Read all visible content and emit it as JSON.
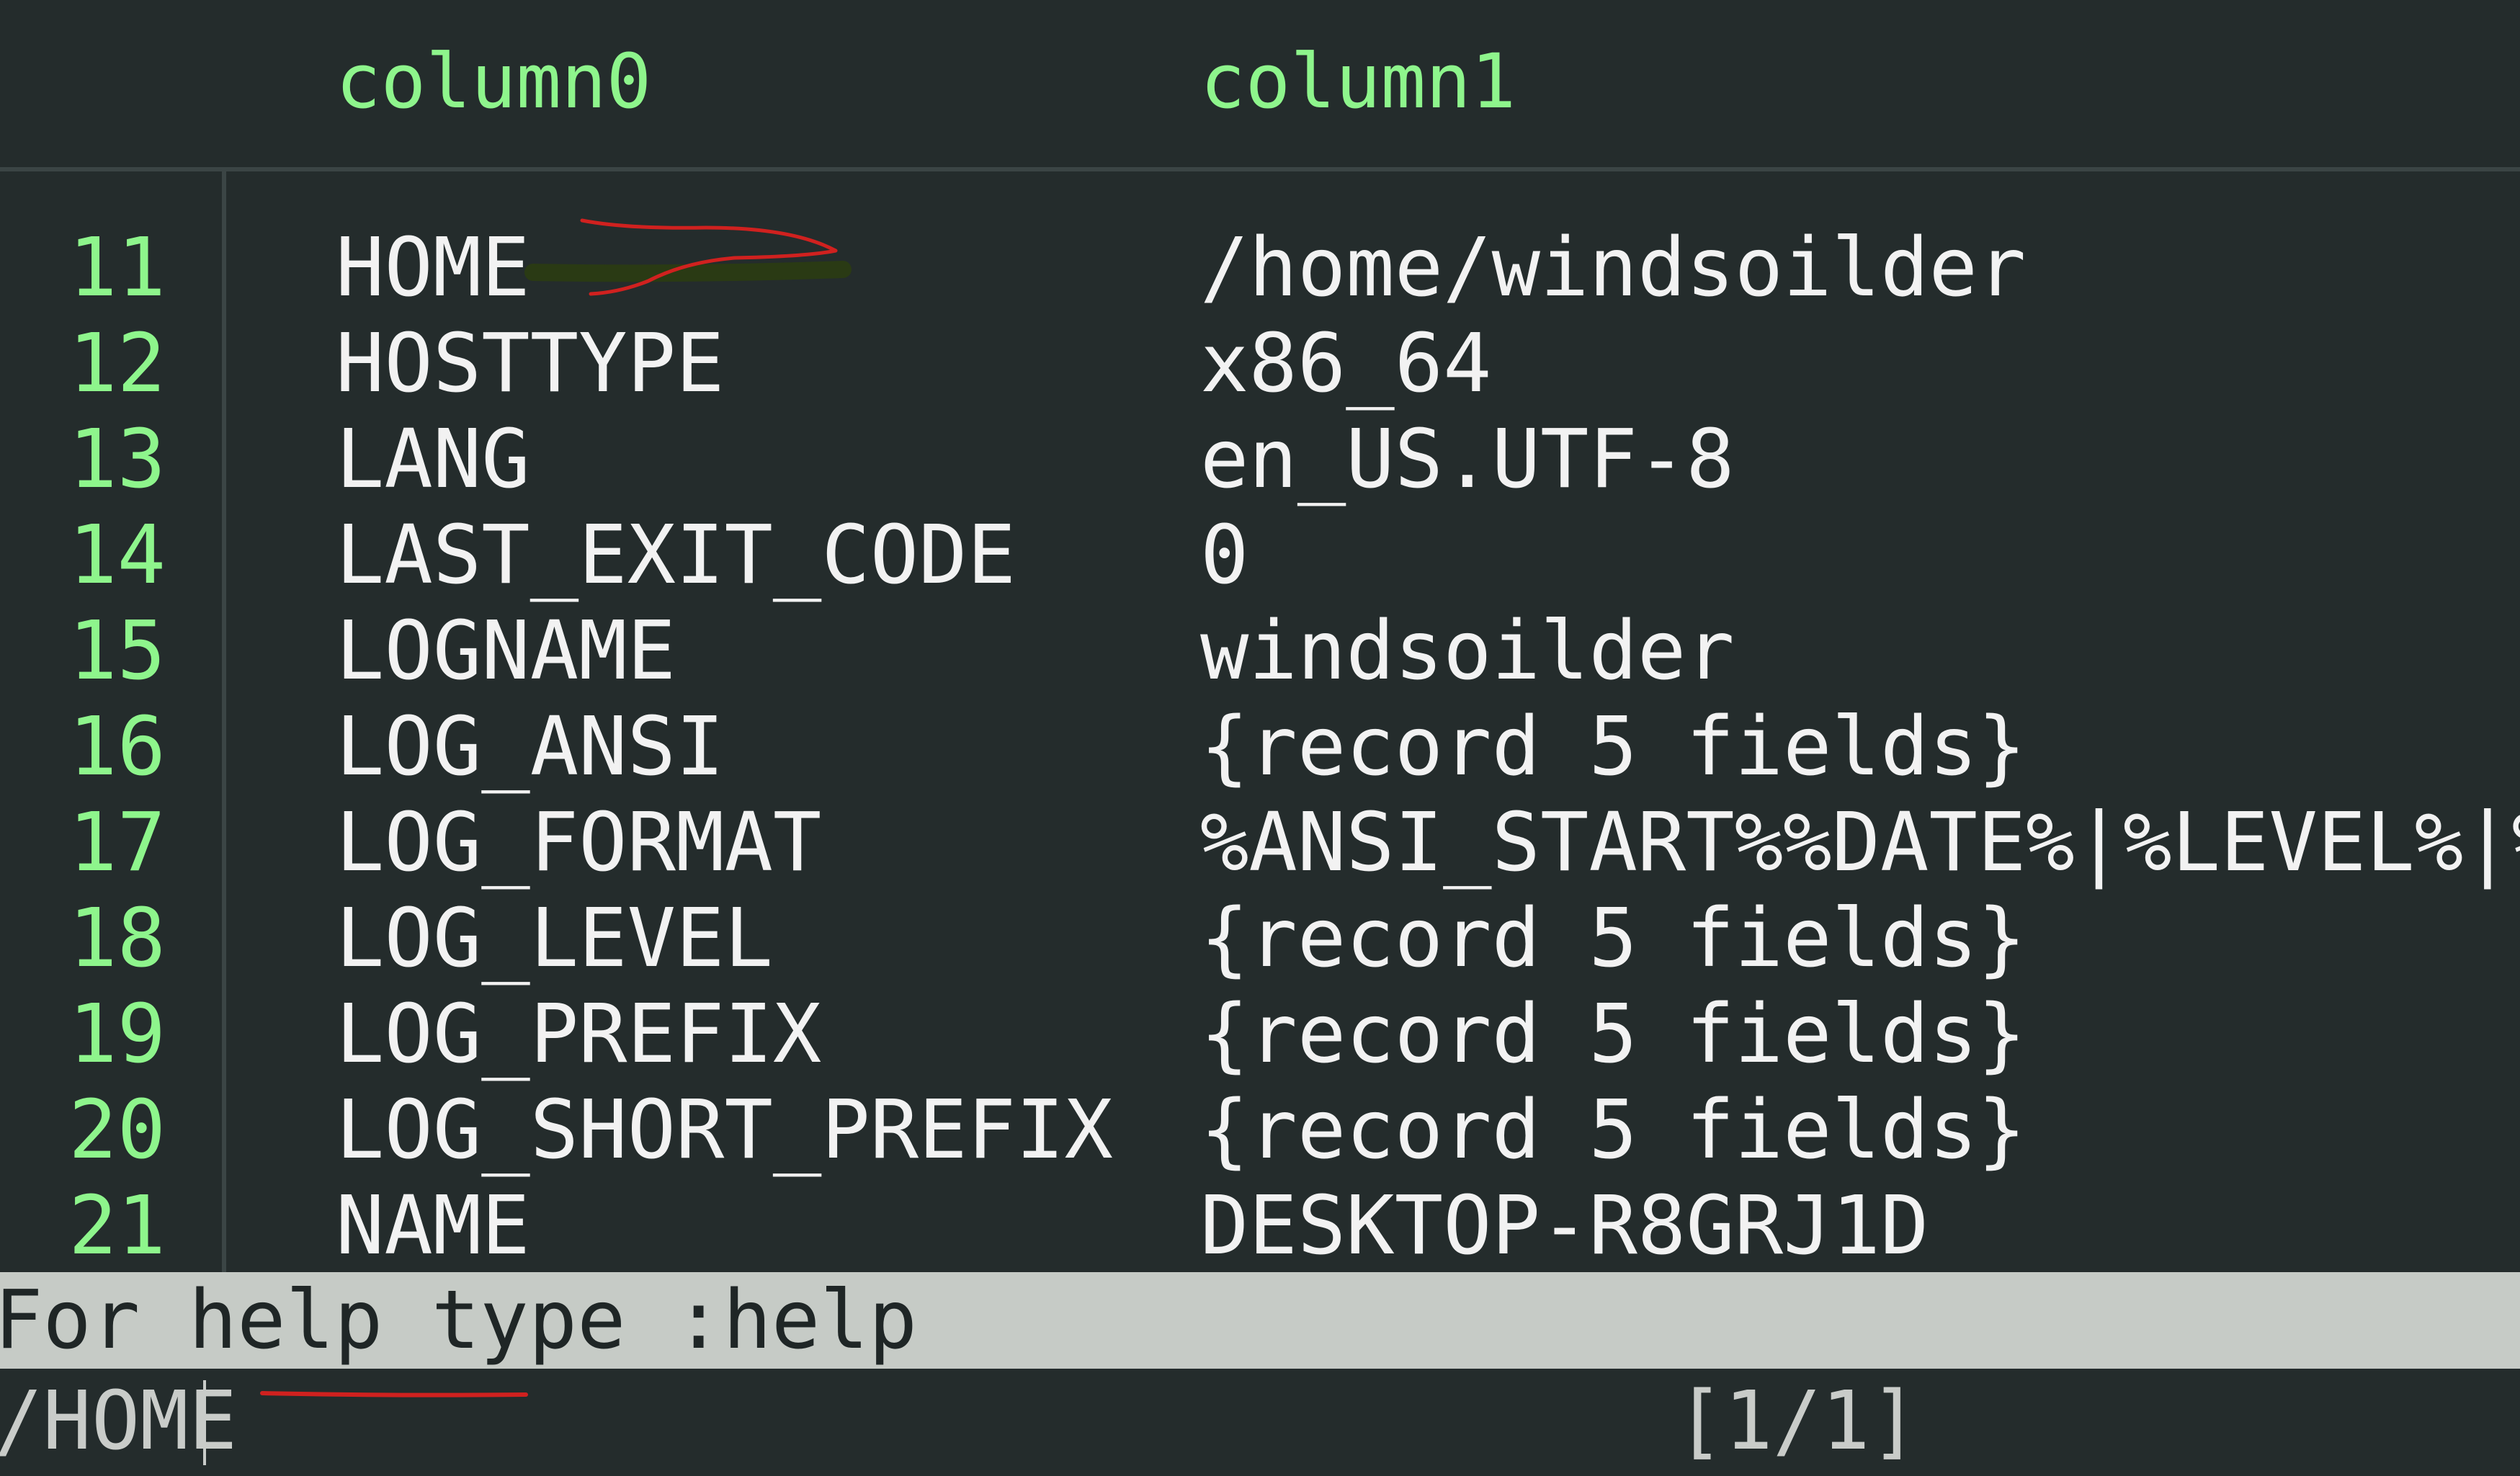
{
  "columns": {
    "col0": "column0",
    "col1": "column1"
  },
  "rows": [
    {
      "index": "11",
      "key": "HOME",
      "value": "/home/windsoilder"
    },
    {
      "index": "12",
      "key": "HOSTTYPE",
      "value": "x86_64"
    },
    {
      "index": "13",
      "key": "LANG",
      "value": "en_US.UTF-8"
    },
    {
      "index": "14",
      "key": "LAST_EXIT_CODE",
      "value": "0"
    },
    {
      "index": "15",
      "key": "LOGNAME",
      "value": "windsoilder"
    },
    {
      "index": "16",
      "key": "LOG_ANSI",
      "value": "{record 5 fields}"
    },
    {
      "index": "17",
      "key": "LOG_FORMAT",
      "value": "%ANSI_START%%DATE%|%LEVEL%|%MSG"
    },
    {
      "index": "18",
      "key": "LOG_LEVEL",
      "value": "{record 5 fields}"
    },
    {
      "index": "19",
      "key": "LOG_PREFIX",
      "value": "{record 5 fields}"
    },
    {
      "index": "20",
      "key": "LOG_SHORT_PREFIX",
      "value": "{record 5 fields}"
    },
    {
      "index": "21",
      "key": "NAME",
      "value": "DESKTOP-R8GRJ1D"
    }
  ],
  "status": {
    "help_text": "For help type :help"
  },
  "command": {
    "input": "/HOME",
    "position": "[1/1]"
  },
  "colors": {
    "background": "#242c2c",
    "accent_green": "#8ef58c",
    "status_bar": "#c6cbc6",
    "annotation_red": "#d0211f"
  }
}
